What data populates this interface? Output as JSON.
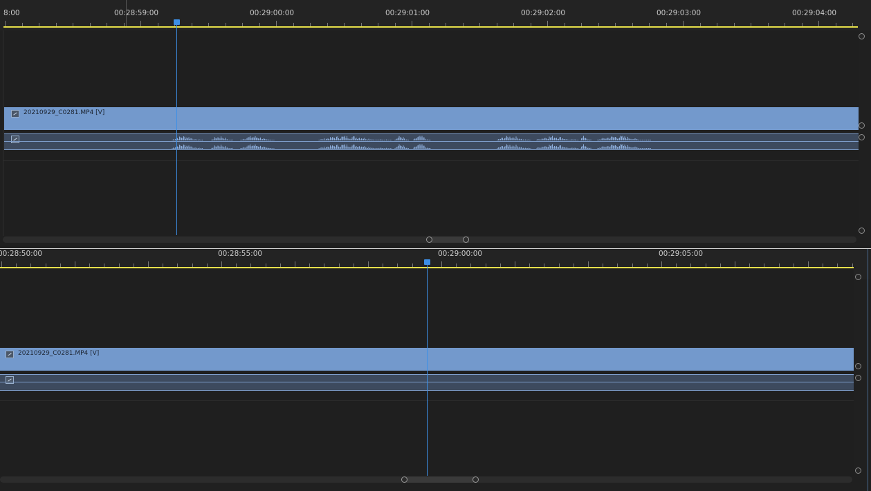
{
  "panels": [
    {
      "name": "timeline-top",
      "timecodes": [
        "8:00",
        "00:28:59:00",
        "00:29:00:00",
        "00:29:01:00",
        "00:29:02:00",
        "00:29:03:00",
        "00:29:04:00"
      ],
      "video_clip_name": "20210929_C0281.MP4 [V]",
      "audio_waveform_visible": true
    },
    {
      "name": "timeline-bottom",
      "timecodes": [
        "00:28:50:00",
        "00:28:55:00",
        "00:29:00:00",
        "00:29:05:00"
      ],
      "video_clip_name": "20210929_C0281.MP4 [V]",
      "audio_waveform_visible": false
    }
  ],
  "colors": {
    "clip_blue": "#7399cc",
    "playhead_blue": "#3d8fe6",
    "inout_yellow": "#e6e04a",
    "background": "#202020"
  }
}
